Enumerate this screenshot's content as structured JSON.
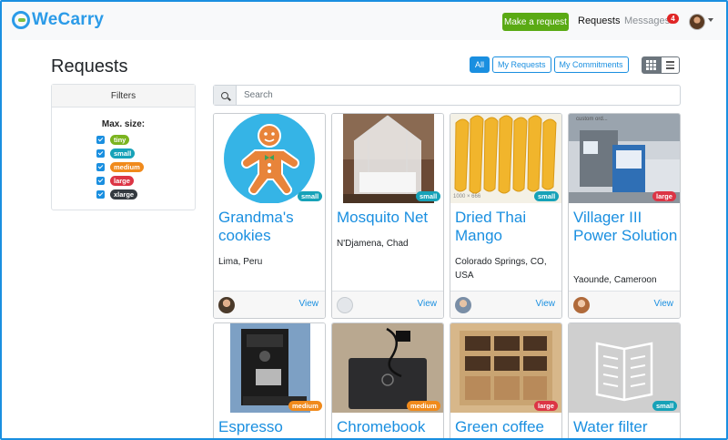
{
  "app": {
    "name": "WeCarry"
  },
  "nav": {
    "make_request": "Make a request",
    "requests": "Requests",
    "messages": "Messages",
    "messages_count": "4"
  },
  "page": {
    "title": "Requests"
  },
  "filter_buttons": [
    "All",
    "My Requests",
    "My Commitments"
  ],
  "filters": {
    "heading": "Filters",
    "max_size_label": "Max. size:",
    "sizes": [
      {
        "label": "tiny",
        "color": "#7bb41f"
      },
      {
        "label": "small",
        "color": "#17a2b8"
      },
      {
        "label": "medium",
        "color": "#f08a1c"
      },
      {
        "label": "large",
        "color": "#dc3545"
      },
      {
        "label": "xlarge",
        "color": "#343a40"
      }
    ]
  },
  "search": {
    "placeholder": "Search"
  },
  "cards": [
    {
      "title": "Grandma's cookies",
      "location": "Lima, Peru",
      "size": "small",
      "view": "View"
    },
    {
      "title": "Mosquito Net",
      "location": "N'Djamena, Chad",
      "size": "small",
      "view": "View"
    },
    {
      "title": "Dried Thai Mango",
      "location": "Colorado Springs, CO, USA",
      "size": "small",
      "view": "View",
      "img_caption": "1000 × 666"
    },
    {
      "title": "Villager III Power Solution",
      "location": "Yaounde, Cameroon",
      "size": "large",
      "view": "View",
      "img_caption": "custom ord..."
    },
    {
      "title": "Espresso",
      "size": "medium"
    },
    {
      "title": "Chromebook",
      "size": "medium"
    },
    {
      "title": "Green coffee",
      "size": "large"
    },
    {
      "title": "Water filter",
      "size": "small"
    }
  ],
  "colors": {
    "primary": "#1a8fe0",
    "success": "#5aaa14",
    "small": "#17a2b8",
    "medium": "#f08a1c",
    "large": "#dc3545"
  }
}
